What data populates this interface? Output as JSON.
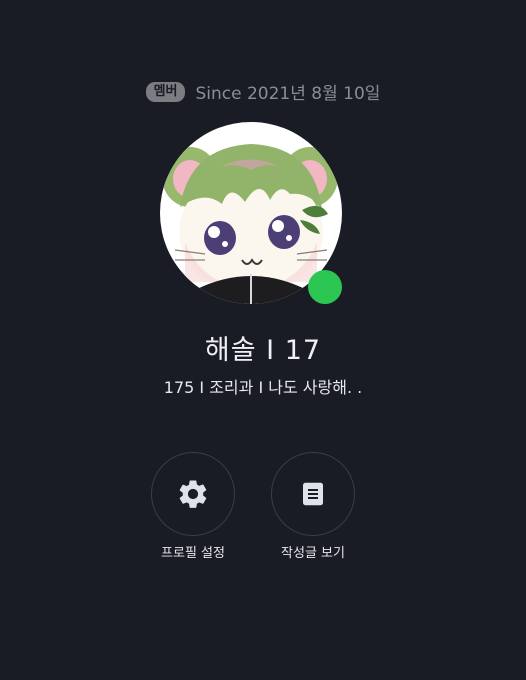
{
  "profile": {
    "badge": "멤버",
    "since": "Since 2021년 8월 10일",
    "name": "해솔 I 17",
    "bio": "175 I 조리과 I 나도 사랑해. .",
    "status_color": "#2cc653"
  },
  "actions": {
    "settings_label": "프로필 설정",
    "posts_label": "작성글 보기"
  },
  "icons": {
    "settings": "gear-icon",
    "posts": "document-icon"
  }
}
